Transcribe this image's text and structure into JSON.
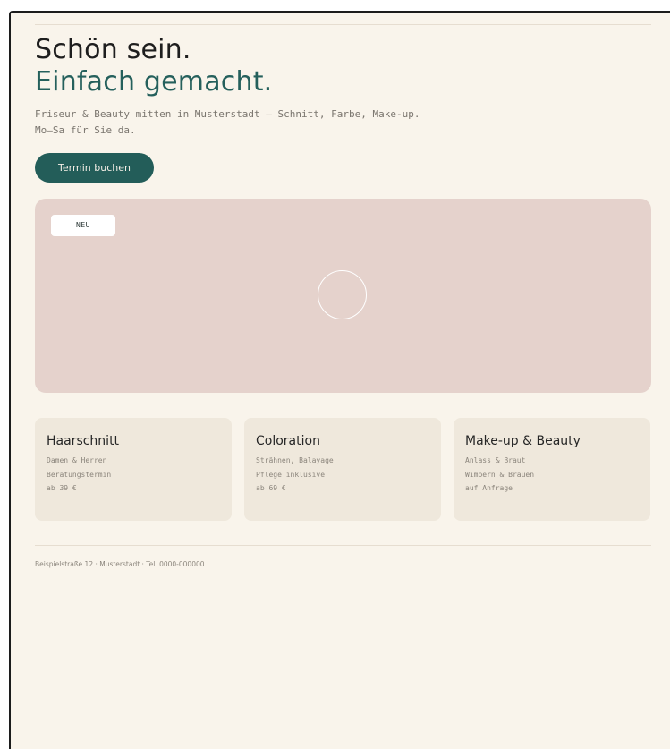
{
  "hero": {
    "title_line1": "Schön sein.",
    "title_line2": "Einfach gemacht.",
    "subtitle_line1": "Friseur & Beauty mitten in Musterstadt — Schnitt, Farbe, Make-up.",
    "subtitle_line2": "Mo–Sa für Sie da.",
    "cta_label": "Termin buchen",
    "accent_color": "#235d59"
  },
  "media": {
    "badge": "NEU",
    "play_icon": "play-circle-icon",
    "background_color": "#e5d2cc"
  },
  "services": [
    {
      "title": "Haarschnitt",
      "line1": "Damen & Herren",
      "line2": "Beratungstermin",
      "line3": "ab 39 €"
    },
    {
      "title": "Coloration",
      "line1": "Strähnen, Balayage",
      "line2": "Pflege inklusive",
      "line3": "ab 69 €"
    },
    {
      "title": "Make-up & Beauty",
      "line1": "Anlass & Braut",
      "line2": "Wimpern & Brauen",
      "line3": "auf Anfrage"
    }
  ],
  "footer": {
    "text": "Beispielstraße 12 · Musterstadt · Tel. 0000-000000"
  }
}
